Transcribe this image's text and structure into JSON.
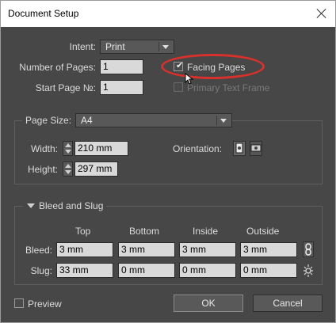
{
  "window": {
    "title": "Document Setup"
  },
  "intent": {
    "label": "Intent:",
    "value": "Print"
  },
  "pages": {
    "number_label": "Number of Pages:",
    "number_value": "1",
    "start_label": "Start Page №:",
    "start_value": "1",
    "facing_label": "Facing Pages",
    "facing_checked": true,
    "primary_label": "Primary Text Frame",
    "primary_checked": false
  },
  "page_size": {
    "label": "Page Size:",
    "value": "A4",
    "width_label": "Width:",
    "width_value": "210 mm",
    "height_label": "Height:",
    "height_value": "297 mm",
    "orientation_label": "Orientation:"
  },
  "bleed_slug": {
    "title": "Bleed and Slug",
    "columns": [
      "Top",
      "Bottom",
      "Inside",
      "Outside"
    ],
    "bleed_label": "Bleed:",
    "bleed_values": [
      "3 mm",
      "3 mm",
      "3 mm",
      "3 mm"
    ],
    "slug_label": "Slug:",
    "slug_values": [
      "33 mm",
      "0 mm",
      "0 mm",
      "0 mm"
    ]
  },
  "footer": {
    "preview_label": "Preview",
    "preview_checked": false,
    "ok_label": "OK",
    "cancel_label": "Cancel"
  },
  "colors": {
    "dialog_bg": "#474747",
    "highlight": "#d8312c",
    "field_bg": "#d9d9d9"
  },
  "icons": [
    "close-icon",
    "dropdown-arrow-icon",
    "checkmark-icon",
    "spinner-icon",
    "portrait-icon",
    "landscape-icon",
    "collapse-triangle-icon",
    "chain-link-icon",
    "broken-chain-icon",
    "cursor-icon"
  ]
}
